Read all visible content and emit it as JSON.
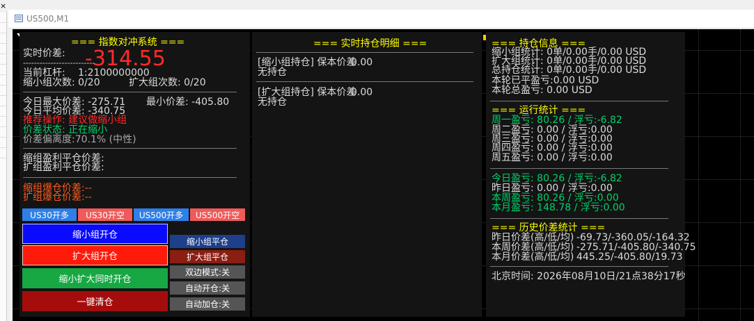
{
  "window": {
    "title": "US500,M1",
    "close_glyph": "×"
  },
  "colors": {
    "yellow": "#ffff00",
    "white": "#ffffff",
    "gray": "#a8a8a8",
    "red": "#ff2a2a",
    "green": "#00d26a",
    "orange": "#ff5a1a",
    "lightgray": "#dcdcdc"
  },
  "panel1": {
    "title": "=== 指数对冲系统 ===",
    "spread_label": "实时价差:",
    "spread_value": "-314.55",
    "dashes_short": "--------------------------",
    "leverage_label": "当前杠杆:",
    "leverage_value": "1:2100000000",
    "shrink_count": "缩小组次数: 0/20",
    "expand_count": "扩大组次数: 0/20",
    "today_max": "今日最大价差: -275.71",
    "today_min": "最小价差: -405.80",
    "today_avg": "今日平均价差: -340.75",
    "recommend": "推荐操作: 建议做缩小组",
    "spread_state": "价差状态: 正在缩小",
    "deviation": "价差偏离度:70.1% (中性)",
    "shrink_close_price": "缩组盈利平仓价差:",
    "expand_close_price": "扩组盈利平仓价差:",
    "shrink_burst": "缩组爆仓价差:--",
    "expand_burst": "扩组爆仓价差:--",
    "buttons": {
      "us30_long": "US30开多",
      "us30_short": "US30开空",
      "us500_long": "US500开多",
      "us500_short": "US500开空",
      "shrink_open": "缩小组开仓",
      "expand_open": "扩大组开仓",
      "both_open": "缩小扩大同时开仓",
      "close_all": "一键清仓",
      "shrink_close": "缩小组平仓",
      "expand_close": "扩大组平仓",
      "dual_mode": "双边模式:关",
      "auto_open": "自动开仓:关",
      "auto_add": "自动加仓:关"
    }
  },
  "panel2": {
    "title": "=== 实时持仓明细 ===",
    "dashes": "------------------------------------------------",
    "shrink_holding": "[缩小组持仓] 保本价差",
    "shrink_value": "0.00",
    "shrink_none": "无持仓",
    "expand_holding": "[扩大组持仓] 保本价差",
    "expand_value": "0.00",
    "expand_none": "无持仓"
  },
  "panel3": {
    "pos_title": "=== 持仓信息 ===",
    "shrink_stat": "缩小组统计: 0单/0.00手/0.00 USD",
    "expand_stat": "扩大组统计: 0单/0.00手/0.00 USD",
    "total_stat": "总持仓统计: 0单/0.00手/0.00 USD",
    "round_closed": "本轮已平盈亏:0.00 USD",
    "round_total": "本轮总盈亏: 0.00 USD",
    "run_title": "=== 运行统计 ===",
    "mon": "周一盈亏: 80.26 / 浮亏:-6.82",
    "tue": "周二盈亏: 0.00 / 浮亏:0.00",
    "wed": "周三盈亏: 0.00 / 浮亏:0.00",
    "thu": "周四盈亏: 0.00 / 浮亏:0.00",
    "fri": "周五盈亏: 0.00 / 浮亏:0.00",
    "today": "今日盈亏: 80.26 / 浮亏:-6.82",
    "yesterday": "昨日盈亏: 0.00 / 浮亏:0.00",
    "week": "本周盈亏: 80.26 / 浮亏:0.00",
    "month": "本月盈亏: 148.78 / 浮亏:0.00",
    "hist_title": "=== 历史价差统计 ===",
    "hist_yesterday_label": "昨日价差(高/低/均)",
    "hist_yesterday_value": "-69.73/-360.05/-164.32",
    "hist_week_label": "本周价差(高/低/均)",
    "hist_week_value": "-275.71/-405.80/-340.75",
    "hist_month_label": "本月价差(高/低/均)",
    "hist_month_value": "445.25/-405.80/19.73",
    "beijing_time": "北京时间: 2026年08月10日/21点38分17秒"
  }
}
